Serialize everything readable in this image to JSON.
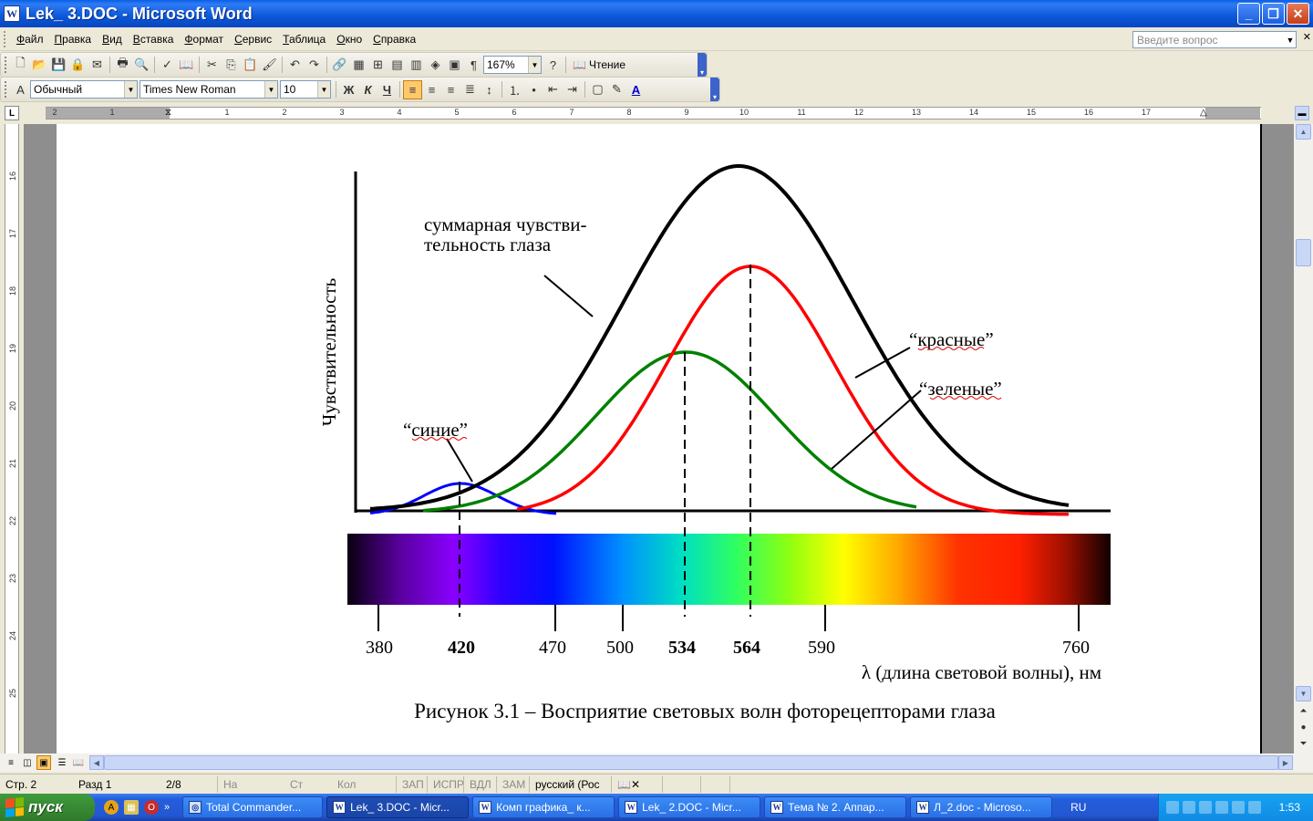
{
  "window": {
    "title": "Lek_ 3.DOC - Microsoft Word",
    "icon": "word-doc-icon"
  },
  "menu": {
    "items": [
      "Файл",
      "Правка",
      "Вид",
      "Вставка",
      "Формат",
      "Сервис",
      "Таблица",
      "Окно",
      "Справка"
    ],
    "help_placeholder": "Введите вопрос"
  },
  "toolbar": {
    "zoom": "167%",
    "reading_label": "Чтение",
    "style": "Обычный",
    "font": "Times New Roman",
    "size": "10"
  },
  "ruler": {
    "h_labels": [
      "2",
      "1",
      "1",
      "2",
      "3",
      "4",
      "5",
      "6",
      "7",
      "8",
      "9",
      "10",
      "11",
      "12",
      "13",
      "14",
      "15",
      "16",
      "17"
    ],
    "v_labels": [
      "16",
      "17",
      "18",
      "19",
      "20",
      "21",
      "22",
      "23",
      "24",
      "25"
    ]
  },
  "figure": {
    "y_axis_label": "Чувствительность",
    "curve_total_label_line1": "суммарная чувстви-",
    "curve_total_label_line2": "тельность глаза",
    "red_label": "“красные”",
    "green_label": "“зеленые”",
    "blue_label": "“синие”",
    "tick_labels": [
      "380",
      "420",
      "470",
      "500",
      "534",
      "564",
      "590",
      "760"
    ],
    "bold_ticks": [
      "420",
      "534",
      "564"
    ],
    "x_axis_label": "λ (длина световой волны), нм",
    "caption": "Рисунок 3.1 – Восприятие световых волн фоторецепторами глаза",
    "colors": {
      "total": "#000000",
      "red": "#FF0000",
      "green": "#008000",
      "blue": "#0000FF"
    }
  },
  "status": {
    "page": "Стр. 2",
    "section": "Разд 1",
    "pages": "2/8",
    "at": "На",
    "line": "Ст",
    "col": "Кол",
    "rec": "ЗАП",
    "trk": "ИСПР",
    "ext": "ВДЛ",
    "ovr": "ЗАМ",
    "language": "русский (Рос"
  },
  "taskbar": {
    "start": "пуск",
    "tasks": [
      {
        "label": "Total Commander...",
        "icon": "tc"
      },
      {
        "label": "Lek_ 3.DOC - Micr...",
        "icon": "W",
        "active": true
      },
      {
        "label": "Комп графика_ к...",
        "icon": "W"
      },
      {
        "label": "Lek_ 2.DOC - Micr...",
        "icon": "W"
      },
      {
        "label": "Тема № 2. Аппар...",
        "icon": "W"
      },
      {
        "label": "Л_2.doc - Microso...",
        "icon": "W"
      }
    ],
    "language": "RU",
    "clock": "1:53"
  }
}
